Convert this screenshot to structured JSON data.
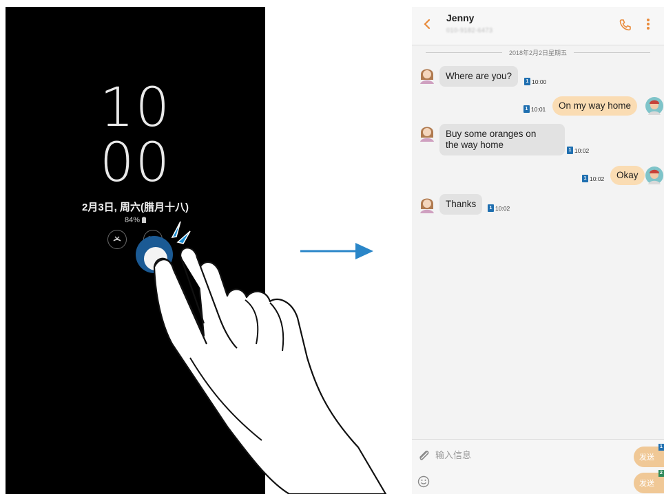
{
  "lockscreen": {
    "hour": "10",
    "minute": "00",
    "date": "2月3日, 周六(腊月十八)",
    "battery": "84%",
    "notification_icons": [
      "missed-call-icon",
      "message-icon"
    ]
  },
  "arrow_icon": "right-arrow-icon",
  "messaging": {
    "contact_name": "Jenny",
    "contact_number": "010-9182-6473",
    "day_separator": "2018年2月2日星期五",
    "messages": [
      {
        "direction": "in",
        "text": "Where are you?",
        "sim": "1",
        "time": "10:00"
      },
      {
        "direction": "out",
        "text": "On my way home",
        "sim": "1",
        "time": "10:01"
      },
      {
        "direction": "in",
        "text_line1": "Buy some oranges on",
        "text_line2": "the way home",
        "sim": "1",
        "time": "10:02"
      },
      {
        "direction": "out",
        "text": "Okay",
        "sim": "1",
        "time": "10:02"
      },
      {
        "direction": "in",
        "text": "Thanks",
        "sim": "1",
        "time": "10:02"
      }
    ],
    "composer": {
      "placeholder": "输入信息",
      "send_sim1": "发送",
      "send_sim2": "发送",
      "sim1_badge": "1",
      "sim2_badge": "2"
    },
    "colors": {
      "incoming_bubble": "#e2e2e2",
      "outgoing_bubble": "#fadcb3",
      "sim_blue": "#1f6fb0",
      "accent_orange": "#e98a3a"
    }
  }
}
